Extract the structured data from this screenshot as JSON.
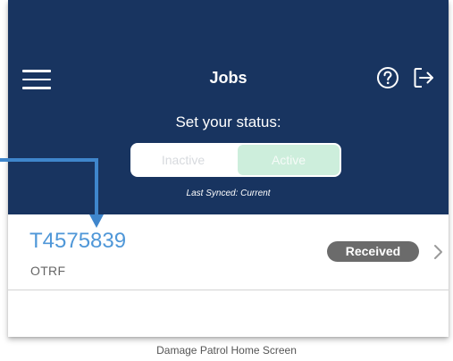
{
  "header": {
    "title": "Jobs",
    "menu_icon": "hamburger-menu-icon",
    "help_icon": "help-circle-icon",
    "logout_icon": "logout-icon",
    "status_label": "Set your status:",
    "status_toggle": {
      "options": [
        "Inactive",
        "Active"
      ],
      "selected": "Active"
    },
    "last_synced": "Last Synced: Current"
  },
  "jobs": [
    {
      "id": "T4575839",
      "subtitle": "OTRF",
      "status": "Received"
    }
  ],
  "caption": "Damage Patrol Home Screen",
  "colors": {
    "header_bg": "#183460",
    "job_id": "#4f97d8",
    "badge_bg": "#6b6b6b",
    "active_segment": "#cdeedc",
    "callout_arrow": "#3f86cc"
  }
}
